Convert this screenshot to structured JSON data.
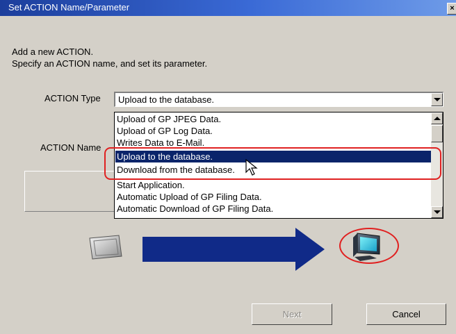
{
  "window": {
    "title": "Set ACTION Name/Parameter",
    "close_glyph": "×"
  },
  "intro": {
    "line1": "Add a new ACTION.",
    "line2": "Specify an ACTION name, and set its parameter."
  },
  "action_type": {
    "label": "ACTION Type",
    "selected_value": "Upload to the database.",
    "options": [
      "Upload of GP JPEG Data.",
      "Upload of GP Log Data.",
      "Writes Data to E-Mail.",
      "Upload to the database.",
      "Download from the database.",
      "Start Application.",
      "Automatic Upload of GP Filing Data.",
      "Automatic Download of GP Filing Data."
    ],
    "highlighted_option": "Upload to the database."
  },
  "action_name": {
    "label": "ACTION Name"
  },
  "buttons": {
    "next": "Next",
    "cancel": "Cancel"
  },
  "icons": {
    "source": "gp-display-icon",
    "direction": "right-arrow-icon",
    "target": "pc-monitor-icon"
  },
  "colors": {
    "titlebar": "#1c3e9c",
    "selection": "#0a246a",
    "arrow": "#102a88",
    "highlight": "#e02020",
    "dialog": "#d4d0c8"
  }
}
